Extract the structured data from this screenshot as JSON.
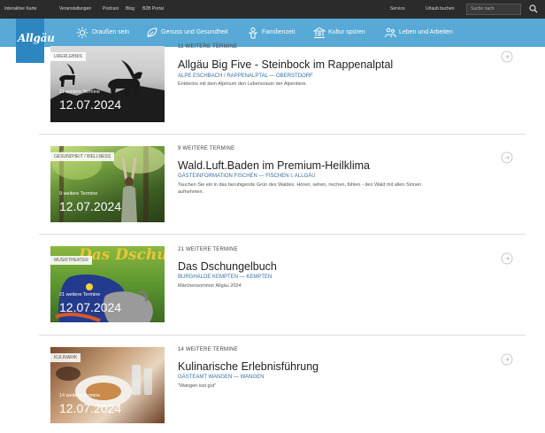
{
  "topbar": {
    "links": [
      "Interaktive Karte",
      "Veranstaltungen",
      "Podcast",
      "Blog",
      "B2B Portal"
    ],
    "right_links": [
      "Service",
      "Urlaub buchen"
    ],
    "search_placeholder": "Suche nach",
    "search_icon": "search-icon"
  },
  "logo": "Allgäu",
  "nav": [
    {
      "label": "Draußen sein",
      "icon": "sun-icon"
    },
    {
      "label": "Genuss und Gesundheit",
      "icon": "leaf-icon"
    },
    {
      "label": "Familienzeit",
      "icon": "family-icon"
    },
    {
      "label": "Kultur spüren",
      "icon": "building-icon"
    },
    {
      "label": "Leben und Arbeiten",
      "icon": "people-icon"
    }
  ],
  "events": [
    {
      "category": "URERLEBNIS",
      "kicker": "11 WEITERE TERMINE",
      "title": "Allgäu Big Five - Steinbock im Rappenalptal",
      "org": "ALPE ESCHBACH / RAPPENALPTAL — OBERSTDORF",
      "description": "Entdecke mit dem Alpinium den Lebensraum der Alpentiere.",
      "more": "11 weitere Termine",
      "date": "12.07.2024"
    },
    {
      "category": "GESUNDHEIT / WELLNESS",
      "kicker": "9 WEITERE TERMINE",
      "title": "Wald.Luft.Baden im Premium-Heilklima",
      "org": "GÄSTEINFORMATION FISCHEN — FISCHEN I. ALLGÄU",
      "description": "Tauchen Sie ein in das beruhigende Grün des Waldes. Hören, sehen, riechen, fühlen - den Wald mit allen Sinnen aufnehmen.",
      "more": "9 weitere Termine",
      "date": "12.07.2024"
    },
    {
      "category": "MUSIKTHEATER",
      "kicker": "21 WEITERE TERMINE",
      "title": "Das Dschungelbuch",
      "org": "BURGHALDE KEMPTEN — KEMPTEN",
      "description": "Märchensommer Allgäu 2024",
      "more": "21 weitere Termine",
      "date": "12.07.2024",
      "image_text": "Das Dschungelbuch"
    },
    {
      "category": "KULINARIK",
      "kicker": "14 WEITERE TERMINE",
      "title": "Kulinarische Erlebnisführung",
      "org": "GÄSTEAMT WANGEN — WANGEN",
      "description": "\"Wangen isst gut\"",
      "more": "14 weitere Termine",
      "date": "12.07.2024"
    }
  ],
  "colors": {
    "topbar": "#2b2b2b",
    "navbar": "#58a9d5",
    "logo": "#2e86c1",
    "org_text": "#3a6fa0"
  }
}
